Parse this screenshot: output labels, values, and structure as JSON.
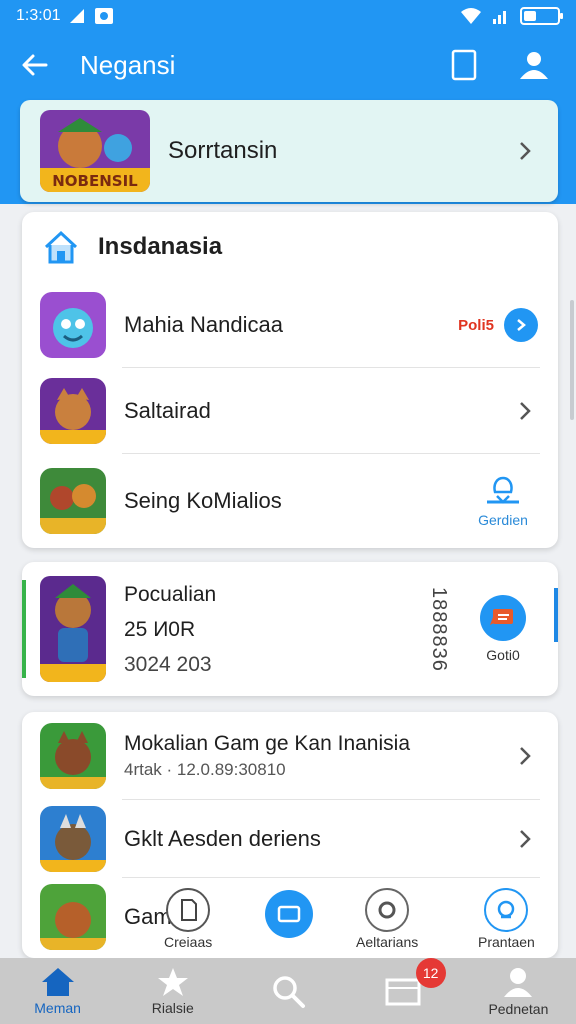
{
  "status": {
    "time": "1:3:01"
  },
  "appbar": {
    "title": "Negansi"
  },
  "featured": {
    "title": "Sorrtansin",
    "thumb_text": "NOBENSIL"
  },
  "section": {
    "title": "Insdanasia"
  },
  "list1": [
    {
      "label": "Mahia Nandicaa",
      "badge": "Poli5",
      "thumb": "blue-creature"
    },
    {
      "label": "Saltairad",
      "thumb": "fox"
    },
    {
      "label": "Seing KoMialios",
      "action_label": "Gerdien",
      "thumb": "battle"
    }
  ],
  "promo": {
    "line1": "Pocualian",
    "line2": "25 И0R",
    "line3": "3024 203",
    "vertical_code": "1888836",
    "button_label": "Goti0"
  },
  "list2": [
    {
      "label": "Mokalian Gam ge Kan Inanisia",
      "sub": "4rtak · 12.0.89:30810"
    },
    {
      "label": "Gklt Aesden deriens"
    },
    {
      "label": "Gam nh"
    }
  ],
  "fab": {
    "left_label": "Creiaas",
    "mid_right_label": "Aeltarians",
    "right_label": "Prantaen"
  },
  "nav": [
    {
      "label": "Meman",
      "icon": "home-icon",
      "active": true
    },
    {
      "label": "Rialsie",
      "icon": "star-icon"
    },
    {
      "label": "",
      "icon": "search-icon"
    },
    {
      "label": "",
      "icon": "inbox-icon",
      "badge": "12"
    },
    {
      "label": "Pednetan",
      "icon": "profile-icon"
    }
  ],
  "colors": {
    "primary": "#2196f3",
    "accent_red": "#e53935",
    "accent_green": "#37b34a",
    "nav_bg": "#c9c9c9"
  }
}
